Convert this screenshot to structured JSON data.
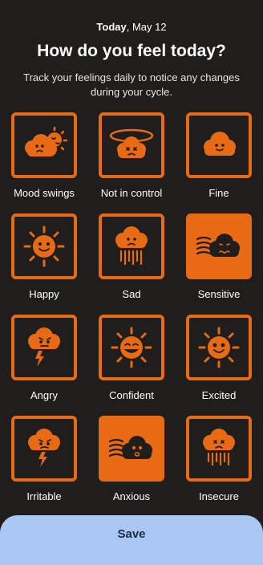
{
  "header": {
    "date_bold": "Today",
    "date_rest": ", May 12",
    "title": "How do you feel today?",
    "subtitle": "Track your feelings daily to notice any changes during your cycle."
  },
  "moods": [
    {
      "label": "Mood swings",
      "icon": "mood-swings-icon",
      "selected": false
    },
    {
      "label": "Not in control",
      "icon": "not-in-control-icon",
      "selected": false
    },
    {
      "label": "Fine",
      "icon": "fine-cloud-icon",
      "selected": false
    },
    {
      "label": "Happy",
      "icon": "happy-sun-icon",
      "selected": false
    },
    {
      "label": "Sad",
      "icon": "sad-rain-cloud-icon",
      "selected": false
    },
    {
      "label": "Sensitive",
      "icon": "sensitive-wind-cloud-icon",
      "selected": true
    },
    {
      "label": "Angry",
      "icon": "angry-storm-cloud-icon",
      "selected": false
    },
    {
      "label": "Confident",
      "icon": "confident-sun-icon",
      "selected": false
    },
    {
      "label": "Excited",
      "icon": "excited-sun-icon",
      "selected": false
    },
    {
      "label": "Irritable",
      "icon": "irritable-storm-cloud-icon",
      "selected": false
    },
    {
      "label": "Anxious",
      "icon": "anxious-wind-cloud-icon",
      "selected": true
    },
    {
      "label": "Insecure",
      "icon": "insecure-rain-cloud-icon",
      "selected": false
    }
  ],
  "save_label": "Save",
  "colors": {
    "accent": "#e86a14",
    "background": "#1f1e1c",
    "save_bg": "#a9c7f2",
    "save_text": "#1c2a47"
  }
}
